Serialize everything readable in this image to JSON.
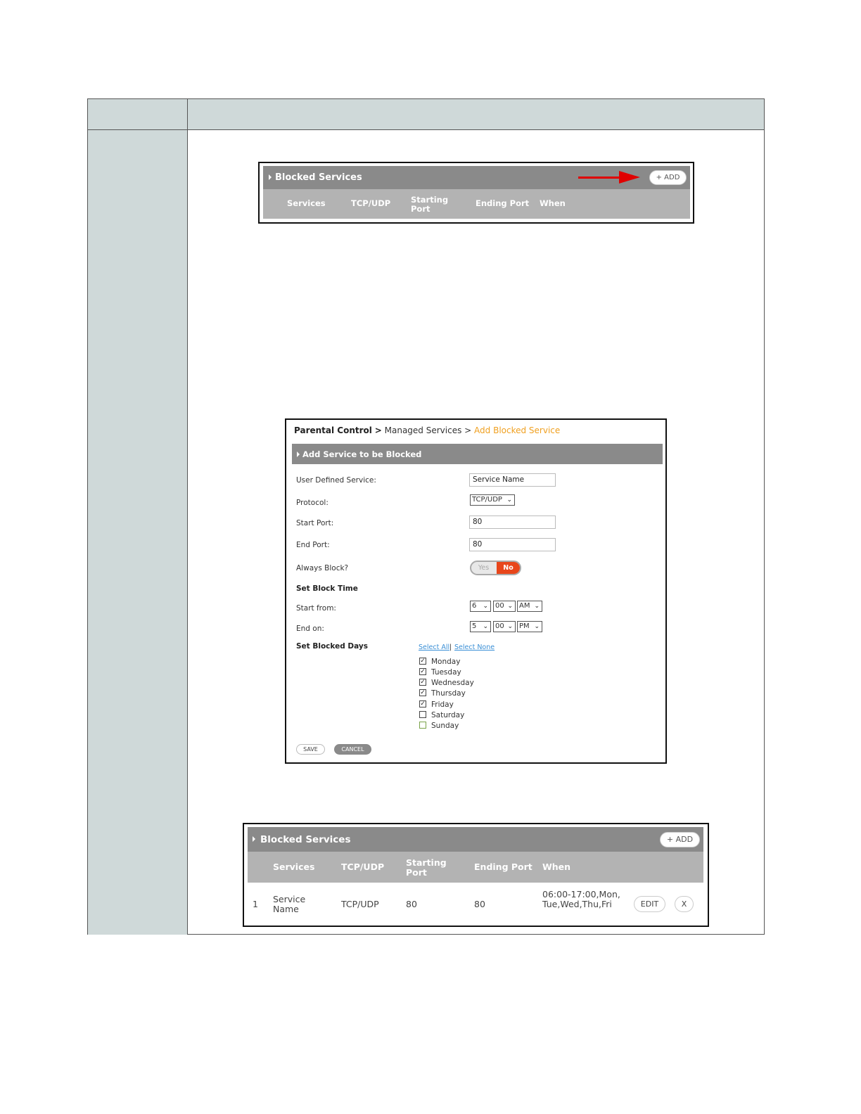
{
  "panel1": {
    "title": "Blocked Services",
    "add_label": "+ ADD",
    "columns": [
      "Services",
      "TCP/UDP",
      "Starting Port",
      "Ending Port",
      "When"
    ]
  },
  "form": {
    "breadcrumb": {
      "root": "Parental Control",
      "sep1": ">",
      "mid": "Managed Services",
      "sep2": ">",
      "current": "Add Blocked Service"
    },
    "section_title": "Add Service to be Blocked",
    "labels": {
      "user_defined_service": "User Defined Service:",
      "protocol": "Protocol:",
      "start_port": "Start Port:",
      "end_port": "End Port:",
      "always_block": "Always Block?",
      "set_block_time": "Set Block Time",
      "start_from": "Start from:",
      "end_on": "End on:",
      "set_blocked_days": "Set Blocked Days"
    },
    "values": {
      "service_name": "Service Name",
      "protocol": "TCP/UDP",
      "start_port": "80",
      "end_port": "80"
    },
    "toggle": {
      "yes": "Yes",
      "no": "No",
      "selected": "No"
    },
    "start_time": {
      "hour": "6",
      "minute": "00",
      "ampm": "AM"
    },
    "end_time": {
      "hour": "5",
      "minute": "00",
      "ampm": "PM"
    },
    "select_all": "Select All",
    "separator": "|",
    "select_none": "Select None",
    "days": [
      {
        "label": "Monday",
        "checked": true
      },
      {
        "label": "Tuesday",
        "checked": true
      },
      {
        "label": "Wednesday",
        "checked": true
      },
      {
        "label": "Thursday",
        "checked": true
      },
      {
        "label": "Friday",
        "checked": true
      },
      {
        "label": "Saturday",
        "checked": false
      },
      {
        "label": "Sunday",
        "checked": false
      }
    ],
    "save_label": "SAVE",
    "cancel_label": "CANCEL"
  },
  "panel2": {
    "title": "Blocked Services",
    "add_label": "+ ADD",
    "columns": [
      "Services",
      "TCP/UDP",
      "Starting Port",
      "Ending Port",
      "When"
    ],
    "rows": [
      {
        "index": "1",
        "service": "Service Name",
        "protocol": "TCP/UDP",
        "start_port": "80",
        "end_port": "80",
        "when": "06:00-17:00,Mon,Tue,Wed,Thu,Fri",
        "edit_label": "EDIT",
        "delete_label": "X"
      }
    ]
  },
  "colors": {
    "accent_orange": "#f0a020",
    "toggle_red": "#e8461b",
    "arrow_red": "#e00000",
    "link_blue": "#3a8fd6",
    "panel_gray": "#8a8a8a"
  }
}
